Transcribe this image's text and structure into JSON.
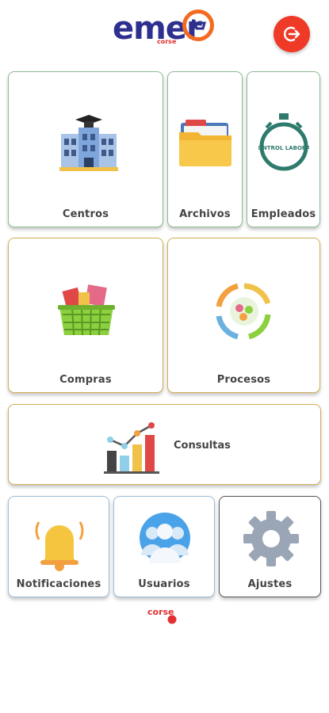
{
  "header": {
    "logo_text": "emer",
    "logo_sub": "corse"
  },
  "tiles": {
    "centros": "Centros",
    "archivos": "Archivos",
    "empleados": "Empleados",
    "empleados_icon_text": "CONTROL LABORAL",
    "compras": "Compras",
    "procesos": "Procesos",
    "consultas": "Consultas",
    "notificaciones": "Notificaciones",
    "usuarios": "Usuarios",
    "ajustes": "Ajustes"
  },
  "footer": {
    "brand": "corse"
  },
  "colors": {
    "accent": "#ee3a26",
    "green_border": "#8dbb8f",
    "gold_border": "#d3ad55",
    "blue_border": "#9ebcd8"
  }
}
